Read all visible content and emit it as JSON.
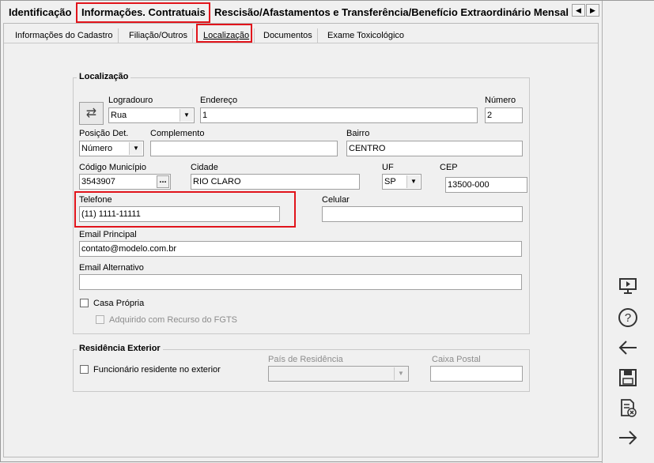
{
  "top_tabs": [
    {
      "label": "Identificação"
    },
    {
      "label": "Informações. Contratuais"
    },
    {
      "label": "Rescisão/Afastamentos e Transferência/Benefício Extraordinário Mensal"
    }
  ],
  "top_tabs_scroll": {
    "left": "◀",
    "right": "▶"
  },
  "sub_tabs": [
    {
      "label": "Informações do Cadastro"
    },
    {
      "label": "Filiação/Outros"
    },
    {
      "label": "Localização"
    },
    {
      "label": "Documentos"
    },
    {
      "label": "Exame Toxicológico"
    }
  ],
  "localizacao": {
    "legend": "Localização",
    "logradouro": {
      "label": "Logradouro",
      "value": "Rua"
    },
    "endereco": {
      "label": "Endereço",
      "value": "1"
    },
    "numero": {
      "label": "Número",
      "value": "2"
    },
    "posicao_det": {
      "label": "Posição Det.",
      "value": "Número"
    },
    "complemento": {
      "label": "Complemento",
      "value": ""
    },
    "bairro": {
      "label": "Bairro",
      "value": "CENTRO"
    },
    "codigo_municipio": {
      "label": "Código Município",
      "value": "3543907",
      "button": "..."
    },
    "cidade": {
      "label": "Cidade",
      "value": "RIO CLARO"
    },
    "uf": {
      "label": "UF",
      "value": "SP"
    },
    "cep": {
      "label": "CEP",
      "value": "13500-000"
    },
    "telefone": {
      "label": "Telefone",
      "value": "(11) 1111-11111"
    },
    "celular": {
      "label": "Celular",
      "value": ""
    },
    "email_principal": {
      "label": "Email Principal",
      "value": "contato@modelo.com.br"
    },
    "email_alternativo": {
      "label": "Email Alternativo",
      "value": ""
    },
    "casa_propria": {
      "label": "Casa Própria",
      "checked": false
    },
    "adquirido_fgts": {
      "label": "Adquirido com Recurso do FGTS",
      "checked": false
    }
  },
  "residencia_exterior": {
    "legend": "Residência Exterior",
    "residente": {
      "label": "Funcionário residente no exterior",
      "checked": false
    },
    "pais": {
      "label": "País de Residência",
      "value": ""
    },
    "caixa_postal": {
      "label": "Caixa Postal",
      "value": ""
    }
  },
  "sidebar_icons": [
    "presentation-icon",
    "help-icon",
    "back-arrow-icon",
    "save-icon",
    "cancel-document-icon",
    "forward-arrow-icon"
  ],
  "colors": {
    "highlight": "#e1141b",
    "background": "#f0f0f0"
  }
}
